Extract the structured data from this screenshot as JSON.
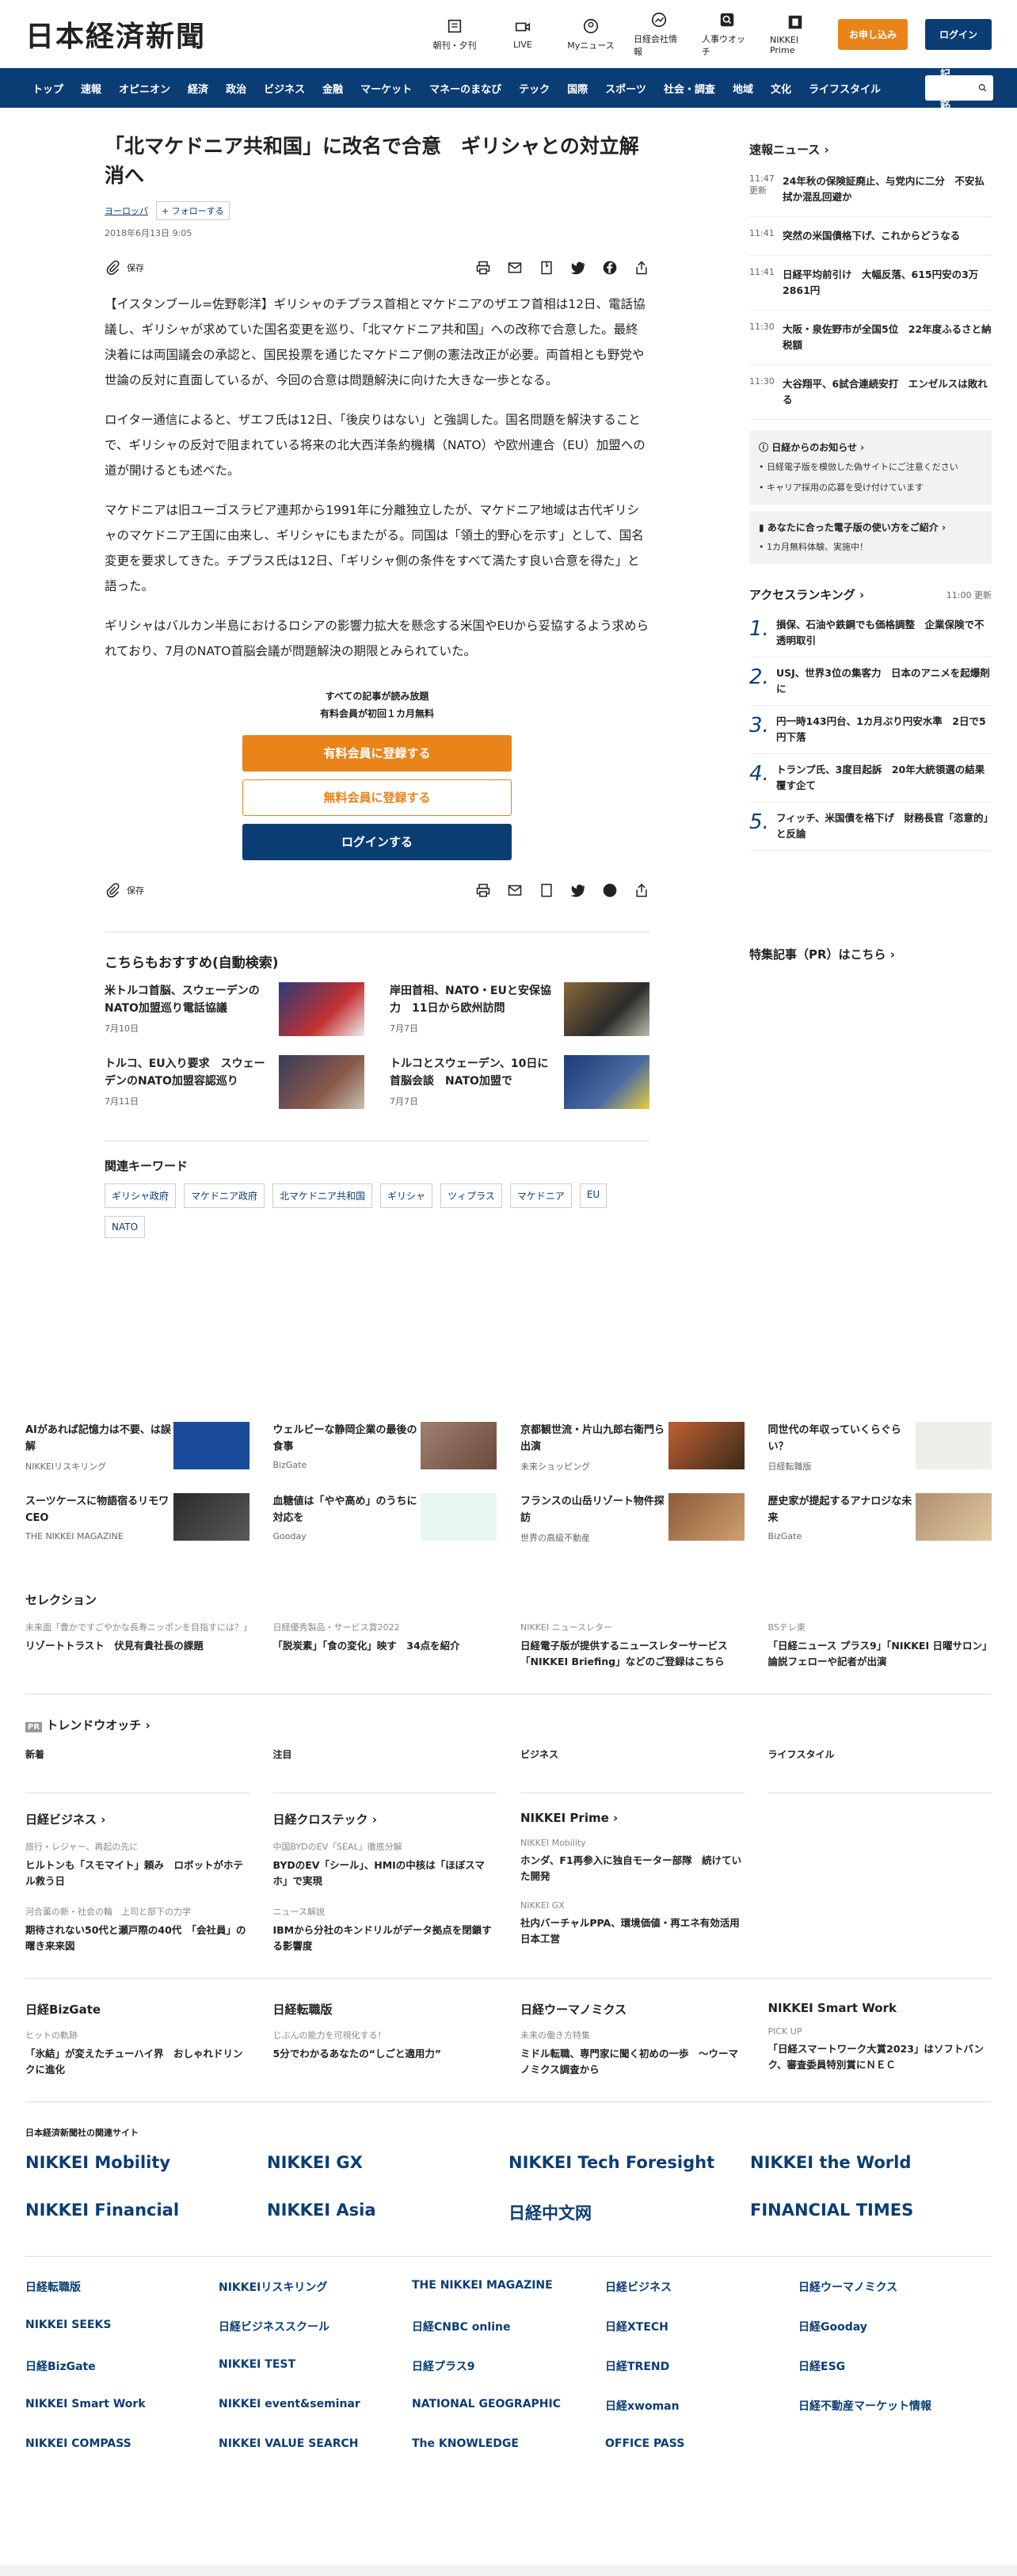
{
  "header": {
    "logo": "日本経済新聞",
    "icons": [
      {
        "label": "朝刊・夕刊",
        "icon": "newspaper-icon"
      },
      {
        "label": "LIVE",
        "icon": "video-icon"
      },
      {
        "label": "Myニュース",
        "icon": "user-icon"
      },
      {
        "label": "日経会社情報",
        "icon": "chart-icon"
      },
      {
        "label": "人事ウオッチ",
        "icon": "search-person-icon"
      },
      {
        "label": "NIKKEI Prime",
        "icon": "prime-icon"
      }
    ],
    "apply": "お申し込み",
    "login": "ログイン"
  },
  "nav": [
    "トップ",
    "速報",
    "オピニオン",
    "経済",
    "政治",
    "ビジネス",
    "金融",
    "マーケット",
    "マネーのまなび",
    "テック",
    "国際",
    "スポーツ",
    "社会・調査",
    "地域",
    "文化",
    "ライフスタイル"
  ],
  "search": {
    "placeholder": "記事・銘"
  },
  "article": {
    "title": "「北マケドニア共和国」に改名で合意　ギリシャとの対立解消へ",
    "region": "ヨーロッパ",
    "follow": "+ フォローする",
    "date": "2018年6月13日 9:05",
    "save": "保存",
    "paragraphs": [
      "【イスタンブール=佐野彰洋】ギリシャのチプラス首相とマケドニアのザエフ首相は12日、電話協議し、ギリシャが求めていた国名変更を巡り、「北マケドニア共和国」への改称で合意した。最終決着には両国議会の承認と、国民投票を通じたマケドニア側の憲法改正が必要。両首相とも野党や世論の反対に直面しているが、今回の合意は問題解決に向けた大きな一歩となる。",
      "ロイター通信によると、ザエフ氏は12日、「後戻りはない」と強調した。国名問題を解決することで、ギリシャの反対で阻まれている将来の北大西洋条約機構（NATO）や欧州連合（EU）加盟への道が開けるとも述べた。",
      "マケドニアは旧ユーゴスラビア連邦から1991年に分離独立したが、マケドニア地域は古代ギリシャのマケドニア王国に由来し、ギリシャにもまたがる。同国は「領土的野心を示す」として、国名変更を要求してきた。チプラス氏は12日、「ギリシャ側の条件をすべて満たす良い合意を得た」と語った。",
      "ギリシャはバルカン半島におけるロシアの影響力拡大を懸念する米国やEUから妥協するよう求められており、7月のNATO首脳会議が問題解決の期限とみられていた。"
    ],
    "paywall": {
      "line1": "すべての記事が読み放題",
      "line2": "有料会員が初回１カ月無料",
      "paid": "有料会員に登録する",
      "free": "無料会員に登録する",
      "login": "ログインする"
    }
  },
  "recommend": {
    "title": "こちらもおすすめ(自動検索)",
    "items": [
      {
        "title": "米トルコ首脳、スウェーデンのNATO加盟巡り電話協議",
        "date": "7月10日"
      },
      {
        "title": "岸田首相、NATO・EUと安保協力　11日から欧州訪問",
        "date": "7月7日"
      },
      {
        "title": "トルコ、EU入り要求　スウェーデンのNATO加盟容認巡り",
        "date": "7月11日"
      },
      {
        "title": "トルコとスウェーデン、10日に首脳会談　NATO加盟で",
        "date": "7月7日"
      }
    ]
  },
  "keywords": {
    "title": "関連キーワード",
    "items": [
      "ギリシャ政府",
      "マケドニア政府",
      "北マケドニア共和国",
      "ギリシャ",
      "ツィプラス",
      "マケドニア",
      "EU",
      "NATO"
    ]
  },
  "sidebar": {
    "breaking": "速報ニュース",
    "news": [
      {
        "time": "11:47",
        "sub": "更新",
        "text": "24年秋の保険証廃止、与党内に二分　不安払拭か混乱回避か"
      },
      {
        "time": "11:41",
        "text": "突然の米国債格下げ、これからどうなる"
      },
      {
        "time": "11:41",
        "text": "日経平均前引け　大幅反落、615円安の3万2861円"
      },
      {
        "time": "11:30",
        "text": "大阪・泉佐野市が全国5位　22年度ふるさと納税額"
      },
      {
        "time": "11:30",
        "text": "大谷翔平、6試合連続安打　エンゼルスは敗れる"
      }
    ],
    "notice": {
      "title": "日経からのお知らせ",
      "items": [
        "日経電子版を模倣した偽サイトにご注意ください",
        "キャリア採用の応募を受け付けています"
      ]
    },
    "howto": {
      "title": "あなたに合った電子版の使い方をご紹介",
      "items": [
        "1カ月無料体験、実施中！"
      ]
    },
    "ranking": {
      "title": "アクセスランキング",
      "time": "11:00 更新",
      "items": [
        "損保、石油や鉄鋼でも価格調整　企業保険で不透明取引",
        "USJ、世界3位の集客力　日本のアニメを起爆剤に",
        "円一時143円台、1カ月ぶり円安水準　2日で5円下落",
        "トランプ氏、3度目起訴　20年大統領選の結果覆す企て",
        "フィッチ、米国債を格下げ　財務長官「恣意的」と反論"
      ]
    },
    "pr": "特集記事（PR）はこちら"
  },
  "ads": [
    {
      "title": "AIがあれば記憶力は不要、は誤解",
      "src": "NIKKEIリスキリング"
    },
    {
      "title": "ウェルビーな静岡企業の最後の食事",
      "src": "BizGate"
    },
    {
      "title": "京都観世流・片山九郎右衛門ら出演",
      "src": "未来ショッピング"
    },
    {
      "title": "同世代の年収っていくらぐらい？",
      "src": "日経転職版"
    },
    {
      "title": "スーツケースに物語宿るリモワCEO",
      "src": "THE NIKKEI MAGAZINE"
    },
    {
      "title": "血糖値は「やや高め」のうちに対応を",
      "src": "Gooday"
    },
    {
      "title": "フランスの山岳リゾート物件探訪",
      "src": "世界の高級不動産"
    },
    {
      "title": "歴史家が提起するアナロジな未来",
      "src": "BizGate"
    }
  ],
  "selection": {
    "title": "セレクション",
    "items": [
      {
        "k": "未来面「豊かですごやかな長寿ニッポンを目指すには？」",
        "t": "リゾートトラスト　伏見有貴社長の課題"
      },
      {
        "k": "日経優秀製品・サービス賞2022",
        "t": "「脱炭素」「食の変化」映す　34点を紹介"
      },
      {
        "k": "NIKKEI ニュースレター",
        "t": "日経電子版が提供するニュースレターサービス「NIKKEI Briefing」などのご登録はこちら"
      },
      {
        "k": "BSテレ東",
        "t": "「日経ニュース プラス9」「NIKKEI 日曜サロン」論説フェローや記者が出演"
      }
    ]
  },
  "trend": {
    "title": "トレンドウオッチ",
    "cols": [
      "新着",
      "注目",
      "ビジネス",
      "ライフスタイル"
    ]
  },
  "groups": [
    {
      "title": "日経ビジネス",
      "items": [
        {
          "k": "旅行・レジャー、再起の先に",
          "t": "ヒルトンも「スモマイト」頼み　ロボットがホテル救う日"
        },
        {
          "k": "河合薫の新・社会の輪　上司と部下の力学",
          "t": "期待されない50代と瀬戸際の40代　「会社員」の曙き来来図"
        }
      ]
    },
    {
      "title": "日経クロステック",
      "items": [
        {
          "k": "中国BYDのEV「SEAL」徹底分解",
          "t": "BYDのEV「シール」、HMIの中核は「ほぼスマホ」で実現"
        },
        {
          "k": "ニュース解説",
          "t": "IBMから分社のキンドリルがデータ拠点を閉鎖する影響度"
        }
      ]
    },
    {
      "title": "NIKKEI Prime",
      "items": [
        {
          "k": "NIKKEI Mobility",
          "t": "ホンダ、F1再参入に独自モーター部隊　続けていた開発"
        },
        {
          "k": "NIKKEI GX",
          "t": "社内バーチャルPPA、環境価値・再エネ有効活用　日本工営"
        }
      ]
    }
  ],
  "groups2": [
    {
      "title": "日経BizGate",
      "k": "ヒットの軌跡",
      "t": "「氷結」が変えたチューハイ界　おしゃれドリンクに進化"
    },
    {
      "title": "日経転職版",
      "k": "じぶんの能力を可視化する！",
      "t": "5分でわかるあなたの“しごと適用力”"
    },
    {
      "title": "日経ウーマノミクス",
      "k": "未来の働き方特集",
      "t": "ミドル転職、専門家に聞く初めの一歩　～ウーマノミクス調査から"
    },
    {
      "title": "NIKKEI Smart Work",
      "k": "PICK UP",
      "t": "「日経スマートワーク大賞2023」はソフトバンク、審査委員特別賞にＮＥＣ"
    }
  ],
  "related": {
    "title": "日本経済新聞社の関連サイト",
    "brands": [
      "NIKKEI Mobility",
      "NIKKEI GX",
      "NIKKEI Tech Foresight",
      "NIKKEI the World",
      "NIKKEI Financial",
      "NIKKEI Asia",
      "日経中文网",
      "FINANCIAL TIMES"
    ],
    "small": [
      "日経転職版",
      "NIKKEIリスキリング",
      "THE NIKKEI MAGAZINE",
      "日経ビジネス",
      "日経ウーマノミクス",
      "NIKKEI SEEKS",
      "日経ビジネススクール",
      "日経CNBC online",
      "日経XTECH",
      "日経Gooday",
      "日経BizGate",
      "NIKKEI TEST",
      "日経プラス9",
      "日経TREND",
      "日経ESG",
      "NIKKEI Smart Work",
      "NIKKEI event&seminar",
      "NATIONAL GEOGRAPHIC",
      "日経xwoman",
      "日経不動産マーケット情報",
      "NIKKEI COMPASS",
      "NIKKEI VALUE SEARCH",
      "The KNOWLEDGE",
      "OFFICE PASS",
      ""
    ]
  }
}
